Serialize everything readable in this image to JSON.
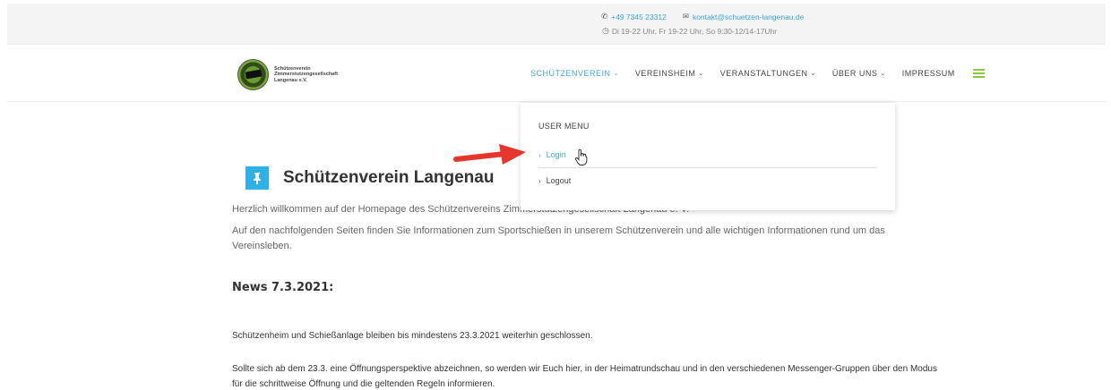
{
  "topbar": {
    "phone": "+49 7345 23312",
    "email": "kontakt@schuetzen-langenau.de",
    "hours": "Di 19-22 Uhr, Fr 19-22 Uhr, So 9:30-12/14-17Uhr"
  },
  "logo": {
    "line1": "Schützenverein",
    "line2": "Zimmerstutzengesellschaft",
    "line3": "Langenau e.V."
  },
  "nav": {
    "items": [
      {
        "label": "SCHÜTZENVEREIN",
        "caret": "⌄"
      },
      {
        "label": "VEREINSHEIM",
        "caret": "⌄"
      },
      {
        "label": "VERANSTALTUNGEN",
        "caret": "⌄"
      },
      {
        "label": "ÜBER UNS",
        "caret": "⌄"
      },
      {
        "label": "IMPRESSUM",
        "caret": ""
      }
    ]
  },
  "dropdown": {
    "title": "USER MENU",
    "login": "Login",
    "logout": "Logout"
  },
  "content": {
    "title": "Schützenverein Langenau",
    "intro": "Herzlich willkommen auf der Homepage des Schützenvereins Zimmerstutzengesellschaft Langenau e. V.",
    "info": "Auf den nachfolgenden Seiten finden Sie Informationen zum Sportschießen in unserem Schützenverein und alle wichtigen Informationen rund um das Vereinsleben.",
    "news_heading": "News 7.3.2021:",
    "news_p1": "Schützenheim und Schießanlage bleiben bis mindestens 23.3.2021 weiterhin geschlossen.",
    "news_p2": "Sollte sich ab dem 23.3. eine Öffnungsperspektive abzeichnen, so werden wir Euch hier, in der Heimatrundschau und in den verschiedenen Messenger-Gruppen über den Modus für die schrittweise Öffnung und die geltenden Regeln informieren."
  },
  "colors": {
    "accent": "#3aa6d8",
    "pin_box": "#2fb1e6",
    "hamburger": "#8cc63f",
    "arrow": "#e8352b"
  }
}
